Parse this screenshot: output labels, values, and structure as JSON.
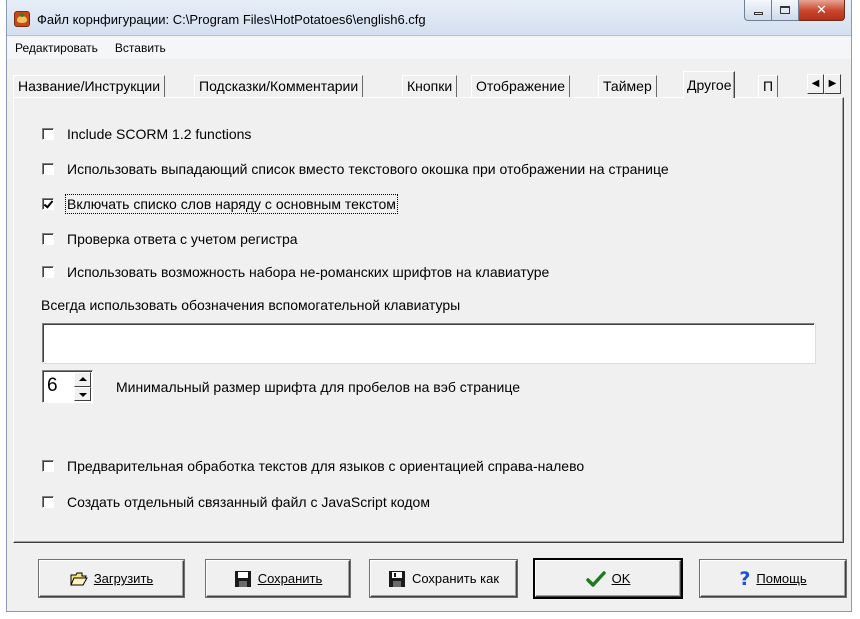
{
  "window": {
    "title": "Файл корнфигурации: C:\\Program Files\\HotPotatoes6\\english6.cfg",
    "close_glyph": "✕"
  },
  "menu": [
    {
      "label": "Редактировать"
    },
    {
      "label": "Вставить"
    }
  ],
  "tabs": [
    {
      "label": "Название/Инструкции",
      "active": false
    },
    {
      "label": "Подсказки/Комментарии",
      "active": false
    },
    {
      "label": "Кнопки",
      "active": false
    },
    {
      "label": "Отображение",
      "active": false
    },
    {
      "label": "Таймер",
      "active": false
    },
    {
      "label": "Другое",
      "active": true
    },
    {
      "label": "П",
      "active": false
    }
  ],
  "tab_scroll": {
    "left": "◀",
    "right": "▶"
  },
  "options": [
    {
      "label": "Include SCORM 1.2 functions",
      "checked": false
    },
    {
      "label": "Использовать выпадающий список вместо текстового окошка при отображении на странице",
      "checked": false
    },
    {
      "label": "Включать списко слов наряду с основным текстом",
      "checked": true
    },
    {
      "label": "Проверка ответа с учетом регистра",
      "checked": false
    },
    {
      "label": "Использовать возможность набора не-романских шрифтов на клавиатуре",
      "checked": false
    }
  ],
  "keyboard_section": {
    "label": "Всегда использовать обозначения вспомогательной клавиатуры",
    "value": ""
  },
  "font_size": {
    "value": "6",
    "label": "Минимальный размер шрифта для пробелов на вэб странице"
  },
  "options_bottom": [
    {
      "label": "Предварительная обработка текстов для языков с ориентацией справа-налево",
      "checked": false
    },
    {
      "label": "Создать отдельный связанный файл с JavaScript кодом",
      "checked": false
    }
  ],
  "buttons": {
    "load": "Загрузить",
    "save": "Сохранить",
    "save_as": "Сохранить как",
    "ok": "OK",
    "help": "Помощь"
  },
  "colors": {
    "dialog_bg": "#f0f0f0",
    "help_icon": "#1f4fd6",
    "ok_check": "#1e7a1e"
  }
}
